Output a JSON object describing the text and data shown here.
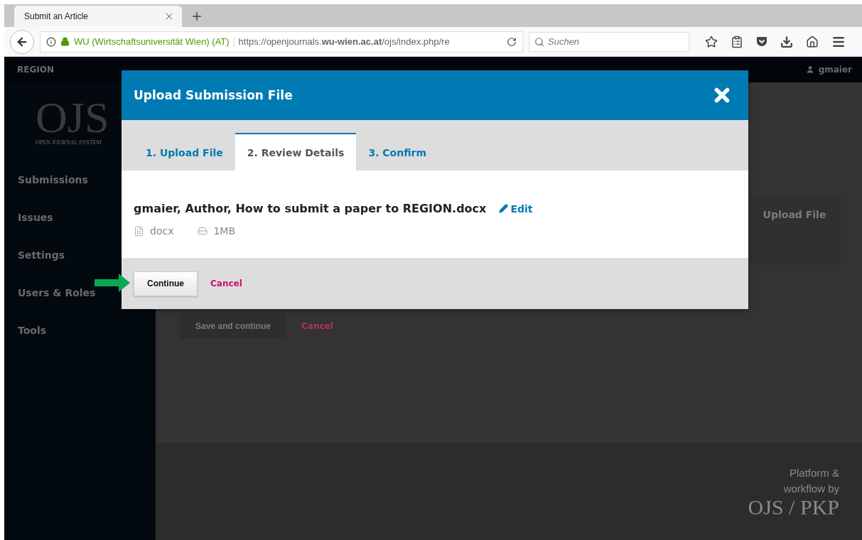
{
  "browser": {
    "tab": {
      "title": "Submit an Article"
    },
    "identity": "WU (Wirtschaftsuniversität Wien) (AT)",
    "url": "https://openjournals.**wu-wien.ac.at**/ojs/index.php/re",
    "search": {
      "placeholder": "Suchen"
    }
  },
  "header": {
    "journal": "REGION",
    "user": "gmaier"
  },
  "sidebar": {
    "logo": "OJS",
    "logo_subtitle": "OPEN JOURNAL SYSTEM",
    "items": [
      "Submissions",
      "Issues",
      "Settings",
      "Users & Roles",
      "Tools"
    ]
  },
  "background": {
    "panel_title": "Upload File",
    "save": "Save and continue",
    "cancel": "Cancel"
  },
  "footer": {
    "text": "Platform & workflow by",
    "logo": "OJS / PKP"
  },
  "modal": {
    "title": "Upload Submission File",
    "tabs": [
      {
        "label": "1. Upload File",
        "selected": false
      },
      {
        "label": "2. Review Details",
        "selected": true
      },
      {
        "label": "3. Confirm",
        "selected": false
      }
    ],
    "file": {
      "name": "gmaier, Author, How to submit a paper to REGION.docx",
      "edit": "Edit",
      "type": "docx",
      "size": "1MB"
    },
    "continue": "Continue",
    "cancel": "Cancel"
  }
}
